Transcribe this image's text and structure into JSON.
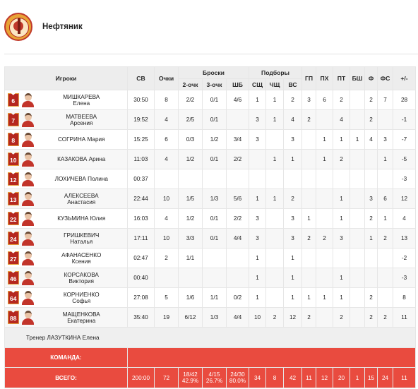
{
  "team": {
    "name": "Нефтяник",
    "logo_icon": "team-logo-icon"
  },
  "colors": {
    "accent": "#e94b3f",
    "jersey": "#b5271f",
    "header_bg": "#ededed"
  },
  "table": {
    "headers": {
      "players": "Игроки",
      "minutes": "СВ",
      "points": "Очки",
      "shots": "Броски",
      "two_pt": "2-очк",
      "three_pt": "3-очк",
      "free_throws": "ШБ",
      "rebounds": "Подборы",
      "def_reb": "СЩ",
      "off_reb": "ЧЩ",
      "total_reb": "ВС",
      "assists": "ГП",
      "steals": "ПХ",
      "turnovers": "ПТ",
      "blocks": "БШ",
      "fouls": "Ф",
      "fouls_drawn": "ФС",
      "plus_minus": "+/-"
    },
    "players": [
      {
        "num": "6",
        "name1": "МИШКАРЕВА",
        "name2": "Елена",
        "min": "30:50",
        "pts": "8",
        "p2": "2/2",
        "p3": "0/1",
        "ft": "4/6",
        "dr": "1",
        "or": "1",
        "tr": "2",
        "ast": "3",
        "stl": "6",
        "to": "2",
        "blk": "",
        "pf": "2",
        "fd": "7",
        "pm": "28"
      },
      {
        "num": "7",
        "name1": "МАТВЕЕВА",
        "name2": "Арсения",
        "min": "19:52",
        "pts": "4",
        "p2": "2/5",
        "p3": "0/1",
        "ft": "",
        "dr": "3",
        "or": "1",
        "tr": "4",
        "ast": "2",
        "stl": "",
        "to": "4",
        "blk": "",
        "pf": "2",
        "fd": "",
        "pm": "-1"
      },
      {
        "num": "8",
        "name1": "СОГРИНА Мария",
        "name2": "",
        "min": "15:25",
        "pts": "6",
        "p2": "0/3",
        "p3": "1/2",
        "ft": "3/4",
        "dr": "3",
        "or": "",
        "tr": "3",
        "ast": "",
        "stl": "1",
        "to": "1",
        "blk": "1",
        "pf": "4",
        "fd": "3",
        "pm": "-7"
      },
      {
        "num": "10",
        "name1": "КАЗАКОВА Арина",
        "name2": "",
        "min": "11:03",
        "pts": "4",
        "p2": "1/2",
        "p3": "0/1",
        "ft": "2/2",
        "dr": "",
        "or": "1",
        "tr": "1",
        "ast": "",
        "stl": "1",
        "to": "2",
        "blk": "",
        "pf": "",
        "fd": "1",
        "pm": "-5"
      },
      {
        "num": "12",
        "name1": "ЛОХИЧЕВА Полина",
        "name2": "",
        "min": "00:37",
        "pts": "",
        "p2": "",
        "p3": "",
        "ft": "",
        "dr": "",
        "or": "",
        "tr": "",
        "ast": "",
        "stl": "",
        "to": "",
        "blk": "",
        "pf": "",
        "fd": "",
        "pm": "-3"
      },
      {
        "num": "13",
        "name1": "АЛЕКСЕЕВА",
        "name2": "Анастасия",
        "min": "22:44",
        "pts": "10",
        "p2": "1/5",
        "p3": "1/3",
        "ft": "5/6",
        "dr": "1",
        "or": "1",
        "tr": "2",
        "ast": "",
        "stl": "",
        "to": "1",
        "blk": "",
        "pf": "3",
        "fd": "6",
        "pm": "12"
      },
      {
        "num": "22",
        "name1": "КУЗЬМИНА Юлия",
        "name2": "",
        "min": "16:03",
        "pts": "4",
        "p2": "1/2",
        "p3": "0/1",
        "ft": "2/2",
        "dr": "3",
        "or": "",
        "tr": "3",
        "ast": "1",
        "stl": "",
        "to": "1",
        "blk": "",
        "pf": "2",
        "fd": "1",
        "pm": "4"
      },
      {
        "num": "24",
        "name1": "ГРИШКЕВИЧ",
        "name2": "Наталья",
        "min": "17:11",
        "pts": "10",
        "p2": "3/3",
        "p3": "0/1",
        "ft": "4/4",
        "dr": "3",
        "or": "",
        "tr": "3",
        "ast": "2",
        "stl": "2",
        "to": "3",
        "blk": "",
        "pf": "1",
        "fd": "2",
        "pm": "13"
      },
      {
        "num": "27",
        "name1": "АФАНАСЕНКО",
        "name2": "Ксения",
        "min": "02:47",
        "pts": "2",
        "p2": "1/1",
        "p3": "",
        "ft": "",
        "dr": "1",
        "or": "",
        "tr": "1",
        "ast": "",
        "stl": "",
        "to": "",
        "blk": "",
        "pf": "",
        "fd": "",
        "pm": "-2"
      },
      {
        "num": "46",
        "name1": "КОРСАКОВА",
        "name2": "Виктория",
        "min": "00:40",
        "pts": "",
        "p2": "",
        "p3": "",
        "ft": "",
        "dr": "1",
        "or": "",
        "tr": "1",
        "ast": "",
        "stl": "",
        "to": "1",
        "blk": "",
        "pf": "",
        "fd": "",
        "pm": "-3"
      },
      {
        "num": "64",
        "name1": "КОРНИЕНКО",
        "name2": "Софья",
        "min": "27:08",
        "pts": "5",
        "p2": "1/6",
        "p3": "1/1",
        "ft": "0/2",
        "dr": "1",
        "or": "",
        "tr": "1",
        "ast": "1",
        "stl": "1",
        "to": "1",
        "blk": "",
        "pf": "2",
        "fd": "",
        "pm": "8"
      },
      {
        "num": "88",
        "name1": "МАЩЕНКОВА",
        "name2": "Екатерина",
        "min": "35:40",
        "pts": "19",
        "p2": "6/12",
        "p3": "1/3",
        "ft": "4/4",
        "dr": "10",
        "or": "2",
        "tr": "12",
        "ast": "2",
        "stl": "",
        "to": "2",
        "blk": "",
        "pf": "2",
        "fd": "2",
        "pm": "11"
      }
    ],
    "coach": "Тренер ЛАЗУТКИНА Елена",
    "team_row": {
      "label": "КОМАНДА:"
    },
    "total_row": {
      "label": "ВСЕГО:",
      "min": "200:00",
      "pts": "72",
      "p2": "18/42",
      "p2_pct": "42.9%",
      "p3": "4/15",
      "p3_pct": "26.7%",
      "ft": "24/30",
      "ft_pct": "80.0%",
      "dr": "34",
      "or": "8",
      "tr": "42",
      "ast": "11",
      "stl": "12",
      "to": "20",
      "blk": "1",
      "pf": "15",
      "fd": "24",
      "pm": "11"
    }
  }
}
